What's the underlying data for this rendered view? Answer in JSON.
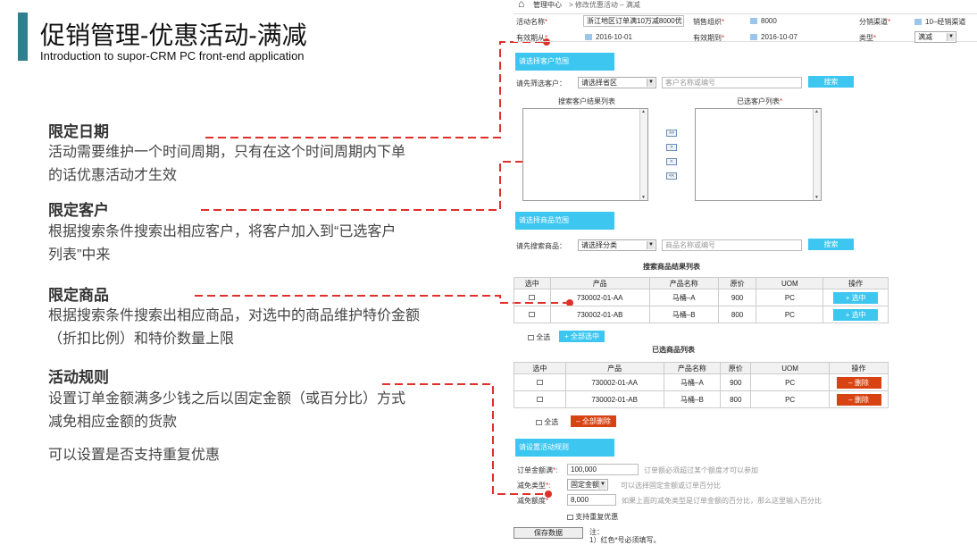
{
  "slide": {
    "title": "促销管理-优惠活动-满减",
    "subtitle": "Introduction to supor-CRM PC front-end application"
  },
  "sections": [
    {
      "heading": "限定日期",
      "lines": [
        "活动需要维护一个时间周期，只有在这个时间周期内下单",
        "的话优惠活动才生效"
      ]
    },
    {
      "heading": "限定客户",
      "lines": [
        "根据搜索条件搜索出相应客户，将客户加入到“已选客户",
        "列表”中来"
      ]
    },
    {
      "heading": "限定商品",
      "lines": [
        "根据搜索条件搜索出相应商品，对选中的商品维护特价金额",
        "（折扣比例）和特价数量上限"
      ]
    },
    {
      "heading": "活动规则",
      "lines": [
        "设置订单金额满多少钱之后以固定金额（或百分比）方式",
        "减免相应金额的货款"
      ]
    },
    {
      "heading": "",
      "lines": [
        "可以设置是否支持重复优惠"
      ]
    }
  ],
  "app": {
    "nav_home": "管理中心",
    "breadcrumb": "> 修改优惠活动 – 满减",
    "form": {
      "name_label": "活动名称",
      "name_value": "浙江地区订单满10万减8000优",
      "org_label": "销售组织",
      "org_value": "8000",
      "channel_label": "分销渠道",
      "channel_value": "10–经销渠道",
      "from_label": "有效期从",
      "from_value": "2016-10-01",
      "to_label": "有效期到",
      "to_value": "2016-10-07",
      "type_label": "类型",
      "type_value": "满减",
      "required_mark": "*"
    },
    "customer": {
      "bar": "请选择客户范围",
      "filter_label": "请先筛选客户：",
      "select_value": "请选择省区",
      "search_placeholder": "客户名称或编号",
      "search_button": "搜索",
      "result_title": "搜索客户结果列表",
      "selected_title": "已选客户列表",
      "move_buttons": [
        ">>",
        ">",
        "<",
        "<<"
      ]
    },
    "product": {
      "bar": "请选择商品范围",
      "filter_label": "请先搜索商品：",
      "select_value": "请选择分类",
      "search_placeholder": "商品名称或编号",
      "search_button": "搜索",
      "result_title": "搜索商品结果列表",
      "columns": [
        "选中",
        "产品",
        "产品名称",
        "原价",
        "UOM",
        "操作"
      ],
      "results": [
        {
          "code": "730002-01-AA",
          "name": "马桶–A",
          "price": "900",
          "uom": "PC",
          "action": "+ 选中"
        },
        {
          "code": "730002-01-AB",
          "name": "马桶–B",
          "price": "800",
          "uom": "PC",
          "action": "+ 选中"
        }
      ],
      "select_all": "全选",
      "select_all_button": "+ 全部选中",
      "selected_title": "已选商品列表",
      "selected": [
        {
          "code": "730002-01-AA",
          "name": "马桶–A",
          "price": "900",
          "uom": "PC",
          "action": "– 删除"
        },
        {
          "code": "730002-01-AB",
          "name": "马桶–B",
          "price": "800",
          "uom": "PC",
          "action": "– 删除"
        }
      ],
      "delete_all_button": "– 全部删除"
    },
    "rule": {
      "bar": "请设置活动规则",
      "amount_label": "订单金额满",
      "amount_value": "100,000",
      "amount_hint": "订单额必须超过某个额度才可以参加",
      "type_label": "减免类型",
      "type_value": "固定金额",
      "type_hint": "可以选择固定金额或订单百分比",
      "deduct_label": "减免额度",
      "deduct_value": "8,000",
      "deduct_hint": "如果上面的减免类型是订单金额的百分比，那么这里输入百分比",
      "repeat_label": "支持重复优惠",
      "save_button": "保存数据",
      "note_label": "注：",
      "note_1": "1）红色*号必须填写。"
    }
  },
  "colors": {
    "accent": "#2f7f90",
    "bar": "#3cc6f0",
    "danger": "#d84314",
    "guide": "#e0302a"
  }
}
